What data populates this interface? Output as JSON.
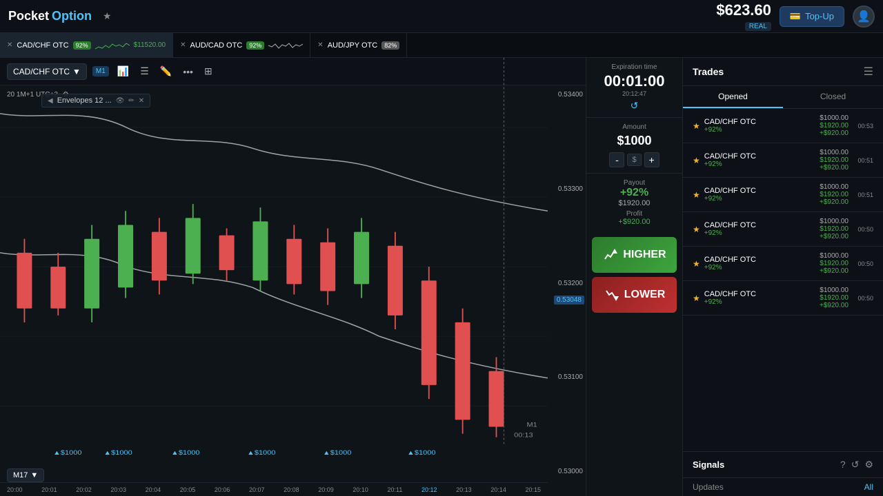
{
  "header": {
    "logo_pocket": "Pocket",
    "logo_option": "Option",
    "balance": "$623.60",
    "balance_label": "REAL",
    "topup_label": "Top-Up"
  },
  "tabs": [
    {
      "symbol": "CAD/CHF OTC",
      "pct": "92%",
      "price": "$11520.00",
      "active": true
    },
    {
      "symbol": "AUD/CAD OTC",
      "pct": "92%",
      "active": false
    },
    {
      "symbol": "AUD/JPY OTC",
      "pct": "82%",
      "active": false
    }
  ],
  "chart": {
    "symbol": "CAD/CHF OTC",
    "info": "20 1M+1   UTC+2",
    "prices": {
      "p1": "0.53400",
      "p2": "0.53300",
      "p3": "0.53200",
      "p4": "0.53100",
      "p5": "0.53000",
      "current": "0.53048"
    },
    "times": [
      "20:00",
      "20:01",
      "20:02",
      "20:03",
      "20:04",
      "20:05",
      "20:06",
      "20:07",
      "20:08",
      "20:09",
      "20:10",
      "20:11",
      "20:12",
      "20:13",
      "20:14",
      "20:15"
    ],
    "indicator": "Envelopes 12 ...",
    "m17": "M17",
    "timer_label": "00:13"
  },
  "trading": {
    "expiration_label": "Expiration time",
    "expiration_time": "00:01:00",
    "expiration_date": "20:12:47",
    "amount_label": "Amount",
    "amount": "$1000",
    "currency": "$",
    "payout_label": "Payout",
    "payout_pct": "+92%",
    "payout_amount": "$1920.00",
    "profit_label": "Profit",
    "profit_amount": "+$920.00",
    "higher_label": "HIGHER",
    "lower_label": "LOWER"
  },
  "trades": {
    "title": "Trades",
    "tab_opened": "Opened",
    "tab_closed": "Closed",
    "items": [
      {
        "symbol": "CAD/CHF OTC",
        "pct": "+92%",
        "invest": "$1000.00",
        "return": "$1920.00",
        "gain": "+$920.00",
        "time": "00:53"
      },
      {
        "symbol": "CAD/CHF OTC",
        "pct": "+92%",
        "invest": "$1000.00",
        "return": "$1920.00",
        "gain": "+$920.00",
        "time": "00:51"
      },
      {
        "symbol": "CAD/CHF OTC",
        "pct": "+92%",
        "invest": "$1000.00",
        "return": "$1920.00",
        "gain": "+$920.00",
        "time": "00:51"
      },
      {
        "symbol": "CAD/CHF OTC",
        "pct": "+92%",
        "invest": "$1000.00",
        "return": "$1920.00",
        "gain": "+$920.00",
        "time": "00:50"
      },
      {
        "symbol": "CAD/CHF OTC",
        "pct": "+92%",
        "invest": "$1000.00",
        "return": "$1920.00",
        "gain": "+$920.00",
        "time": "00:50"
      },
      {
        "symbol": "CAD/CHF OTC",
        "pct": "+92%",
        "invest": "$1000.00",
        "return": "$1920.00",
        "gain": "+$920.00",
        "time": "00:50"
      }
    ],
    "signals_label": "Signals",
    "updates_label": "Updates",
    "all_label": "All"
  }
}
